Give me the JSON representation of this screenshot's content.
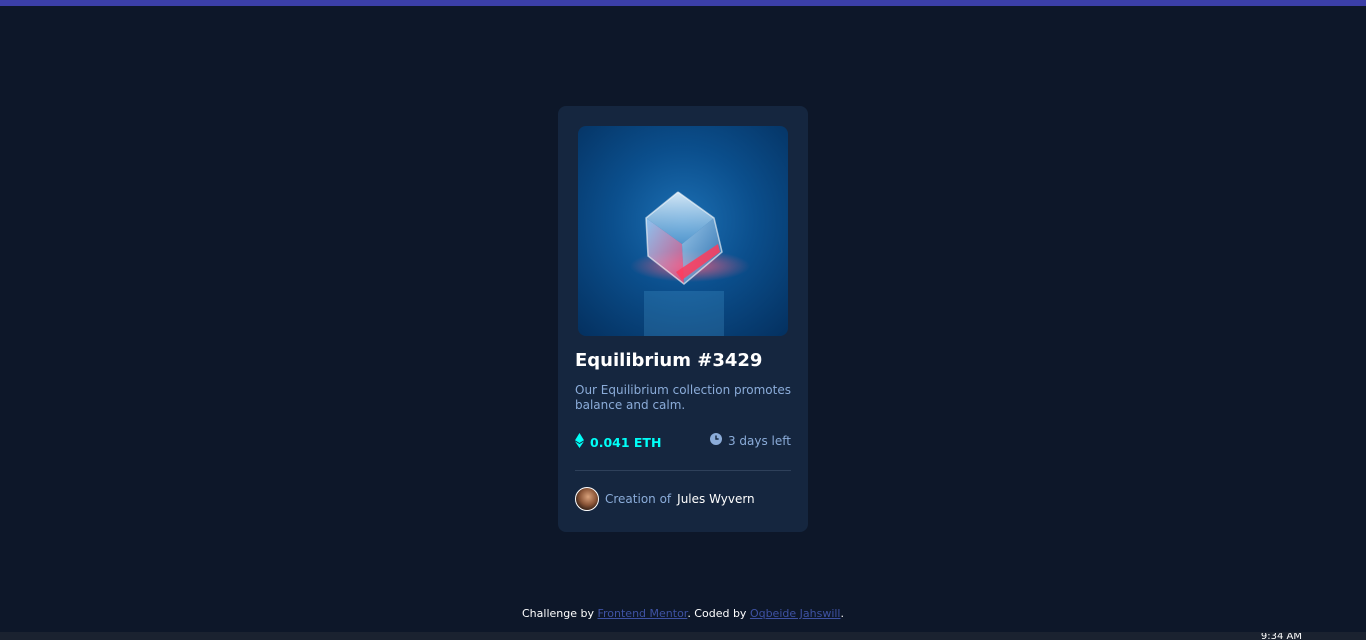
{
  "card": {
    "image_alt": "Equilibrium crystal cube image",
    "title": "Equilibrium #3429",
    "description": "Our Equilibrium collection promotes balance and calm.",
    "price": "0.041 ETH",
    "time_left": "3 days left",
    "creation_prefix": "Creation of",
    "creator_name": "Jules Wyvern"
  },
  "attribution": {
    "prefix": "Challenge by",
    "link1": "Frontend Mentor",
    "middle": ". Coded by",
    "link2": "Oqbeide Jahswill",
    "suffix": "."
  },
  "taskbar": {
    "clock": "9:34 AM"
  },
  "colors": {
    "page_bg": "#0d1729",
    "card_bg": "#15263f",
    "accent_cyan": "#00fff8",
    "soft_blue": "#8bacd9",
    "link_blue": "#3e52a3",
    "top_strip": "#3b3fa8"
  },
  "icons": {
    "price": "ethereum-icon",
    "time": "clock-icon"
  }
}
